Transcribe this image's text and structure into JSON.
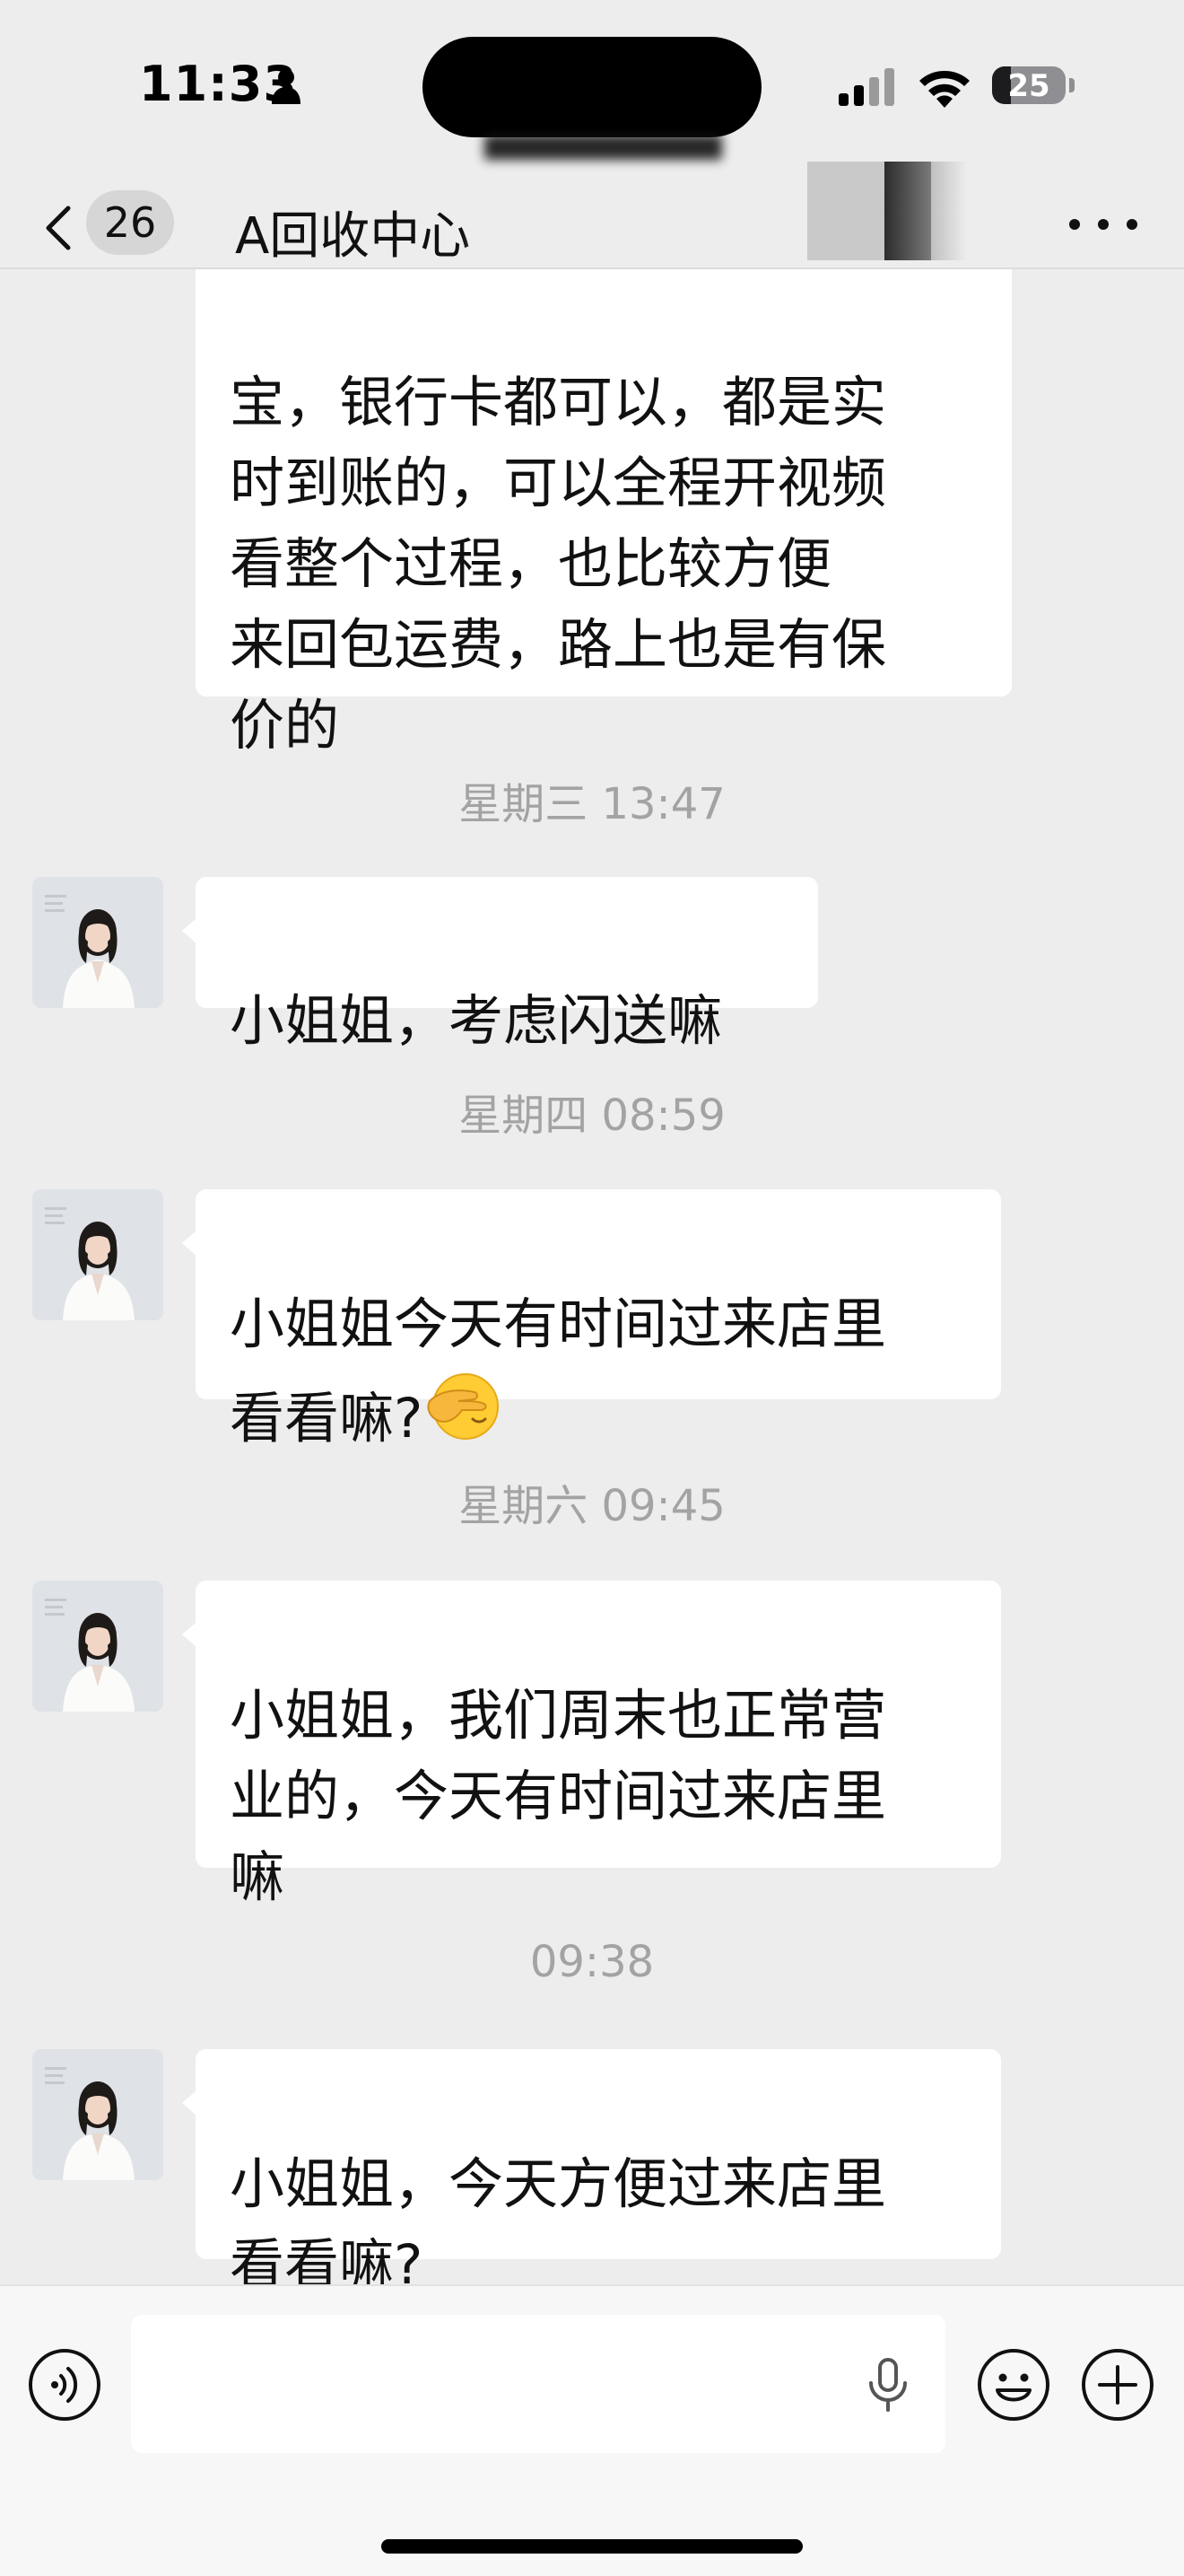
{
  "status_bar": {
    "time": "11:33",
    "battery_level": "25",
    "battery_fraction": 0.25,
    "icons": [
      "person-icon",
      "signal-icon",
      "wifi-icon",
      "battery-icon"
    ]
  },
  "nav": {
    "back_icon": "chevron-left-icon",
    "unread_count": "26",
    "title": "A回收中心",
    "more_icon": "more-dots-icon"
  },
  "messages": [
    {
      "type": "text",
      "sender": "contact",
      "text": "宝，银行卡都可以，都是实\n时到账的，可以全程开视频\n看整个过程，也比较方便\n来回包运费，路上也是有保\n价的"
    },
    {
      "type": "time",
      "text": "星期三 13:47"
    },
    {
      "type": "text",
      "sender": "contact",
      "text": "小姐姐，考虑闪送嘛"
    },
    {
      "type": "time",
      "text": "星期四 08:59"
    },
    {
      "type": "text",
      "sender": "contact",
      "text": "小姐姐今天有时间过来店里\n看看嘛?",
      "emoji": "face-with-hand-over-eye"
    },
    {
      "type": "time",
      "text": "星期六 09:45"
    },
    {
      "type": "text",
      "sender": "contact",
      "text": "小姐姐，我们周末也正常营\n业的，今天有时间过来店里\n嘛"
    },
    {
      "type": "time",
      "text": "09:38"
    },
    {
      "type": "text",
      "sender": "contact",
      "text": "小姐姐，今天方便过来店里\n看看嘛?"
    }
  ],
  "input_bar": {
    "voice_icon": "voice-icon",
    "text_value": "",
    "mic_icon": "microphone-icon",
    "emoji_icon": "emoji-icon",
    "plus_icon": "plus-icon"
  },
  "colors": {
    "background": "#ededed",
    "bubble": "#ffffff",
    "timestamp": "#a3a3a3",
    "input_bar": "#f7f7f7"
  }
}
